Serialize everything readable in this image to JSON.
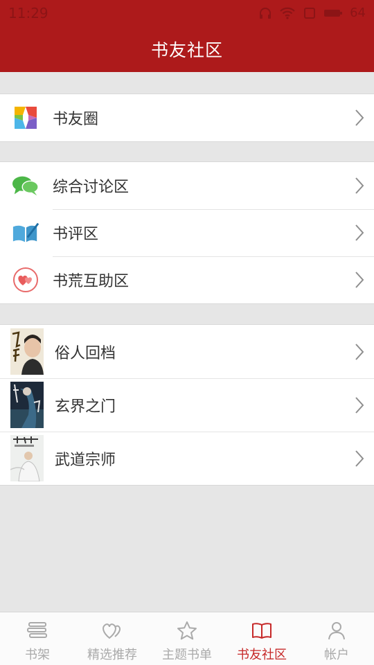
{
  "status": {
    "time": "11:29",
    "battery": "64"
  },
  "header": {
    "title": "书友社区"
  },
  "groups": {
    "moments": [
      {
        "label": "书友圈",
        "icon": "pinwheel-icon"
      }
    ],
    "forums": [
      {
        "label": "综合讨论区",
        "icon": "chat-bubbles-icon"
      },
      {
        "label": "书评区",
        "icon": "book-pen-icon"
      },
      {
        "label": "书荒互助区",
        "icon": "hearts-icon"
      }
    ],
    "books": [
      {
        "label": "俗人回档",
        "icon": "book-cover"
      },
      {
        "label": "玄界之门",
        "icon": "book-cover"
      },
      {
        "label": "武道宗师",
        "icon": "book-cover"
      }
    ]
  },
  "tabs": [
    {
      "label": "书架",
      "icon": "bookshelf-icon",
      "active": false
    },
    {
      "label": "精选推荐",
      "icon": "heart-icon",
      "active": false
    },
    {
      "label": "主题书单",
      "icon": "star-icon",
      "active": false
    },
    {
      "label": "书友社区",
      "icon": "open-book-icon",
      "active": true
    },
    {
      "label": "帐户",
      "icon": "user-icon",
      "active": false
    }
  ],
  "colors": {
    "brand": "#ad1a1b",
    "active_tab": "#c62828",
    "inactive_tab": "#aaaaaa"
  }
}
